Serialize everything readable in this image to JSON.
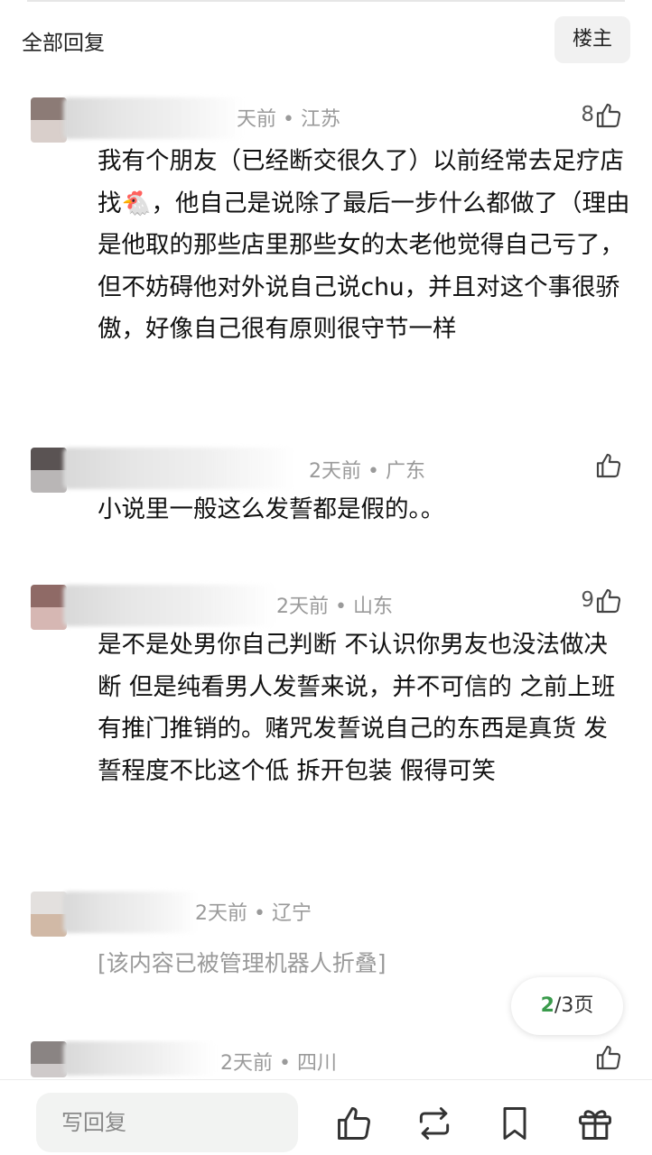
{
  "header": {
    "title": "全部回复",
    "op_filter": "楼主"
  },
  "comments": [
    {
      "meta": "天前 • 江苏",
      "likes": "8",
      "text": "我有个朋友（已经断交很久了）以前经常去足疗店找🐔，他自己是说除了最后一步什么都做了（理由是他取的那些店里那些女的太老他觉得自己亏了，但不妨碍他对外说自己说chu，并且对这个事很骄傲，好像自己很有原则很守节一样",
      "avatar_colors": [
        "#8c7b76",
        "#d9cfcb"
      ]
    },
    {
      "meta": "2天前 • 广东",
      "likes": "",
      "text": "小说里一般这么发誓都是假的。。",
      "avatar_colors": [
        "#5a5353",
        "#b9b6b6"
      ]
    },
    {
      "meta": "2天前 • 山东",
      "likes": "9",
      "text": "是不是处男你自己判断 不认识你男友也没法做决断 但是纯看男人发誓来说，并不可信的   之前上班 有推门推销的。赌咒发誓说自己的东西是真货  发誓程度不比这个低  拆开包装 假得可笑",
      "avatar_colors": [
        "#8f6a66",
        "#d6b7b3"
      ]
    },
    {
      "meta": "2天前 • 辽宁",
      "likes": "",
      "text": "[该内容已被管理机器人折叠]",
      "avatar_colors": [
        "#e3e0de",
        "#d1b9a6"
      ]
    },
    {
      "meta": "2天前 • 四川",
      "likes": "",
      "text": "",
      "avatar_colors": [
        "#8a8483",
        "#cfcaca"
      ]
    }
  ],
  "pagination": {
    "current": "2",
    "total_label": "/3页"
  },
  "bottom_bar": {
    "reply_placeholder": "写回复",
    "icons": [
      "like-icon",
      "repost-icon",
      "bookmark-icon",
      "gift-icon"
    ]
  }
}
